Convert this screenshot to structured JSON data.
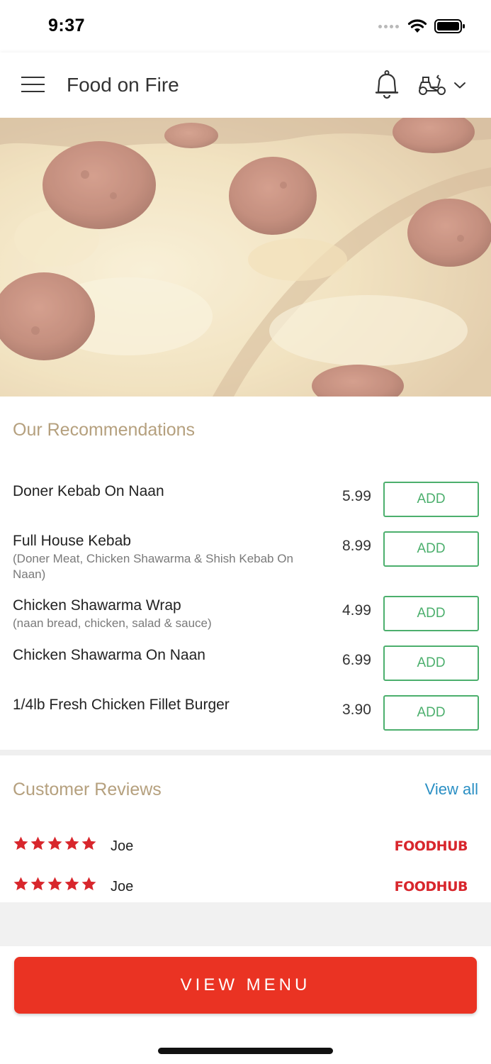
{
  "status_bar": {
    "time": "9:37",
    "icons": [
      "signal-dots-icon",
      "wifi-icon",
      "battery-icon"
    ]
  },
  "header": {
    "title": "Food on Fire",
    "icons": [
      "hamburger-menu-icon",
      "bell-icon",
      "scooter-icon",
      "chevron-down-icon"
    ]
  },
  "hero": {
    "subject": "pepperoni pizza"
  },
  "recommendations": {
    "title": "Our Recommendations",
    "add_label": "ADD",
    "items": [
      {
        "name": "Doner Kebab On Naan",
        "desc": "",
        "price": "5.99"
      },
      {
        "name": "Full House Kebab",
        "desc": "(Doner Meat, Chicken Shawarma & Shish Kebab On Naan)",
        "price": "8.99"
      },
      {
        "name": "Chicken Shawarma Wrap",
        "desc": "(naan bread, chicken, salad & sauce)",
        "price": "4.99"
      },
      {
        "name": "Chicken Shawarma On Naan",
        "desc": "",
        "price": "6.99"
      },
      {
        "name": "1/4lb Fresh Chicken Fillet Burger",
        "desc": "",
        "price": "3.90"
      }
    ]
  },
  "reviews": {
    "title": "Customer Reviews",
    "view_all": "View all",
    "items": [
      {
        "rating": 5,
        "name": "Joe",
        "source": "FOODHUB"
      },
      {
        "rating": 5,
        "name": "Joe",
        "source": "FOODHUB"
      }
    ]
  },
  "cta": {
    "label": "VIEW MENU"
  },
  "colors": {
    "accent_red": "#ea3323",
    "add_green": "#4caf6d",
    "section_title": "#b5a07e",
    "link_blue": "#2a8fc4",
    "star_red": "#d8262c"
  }
}
